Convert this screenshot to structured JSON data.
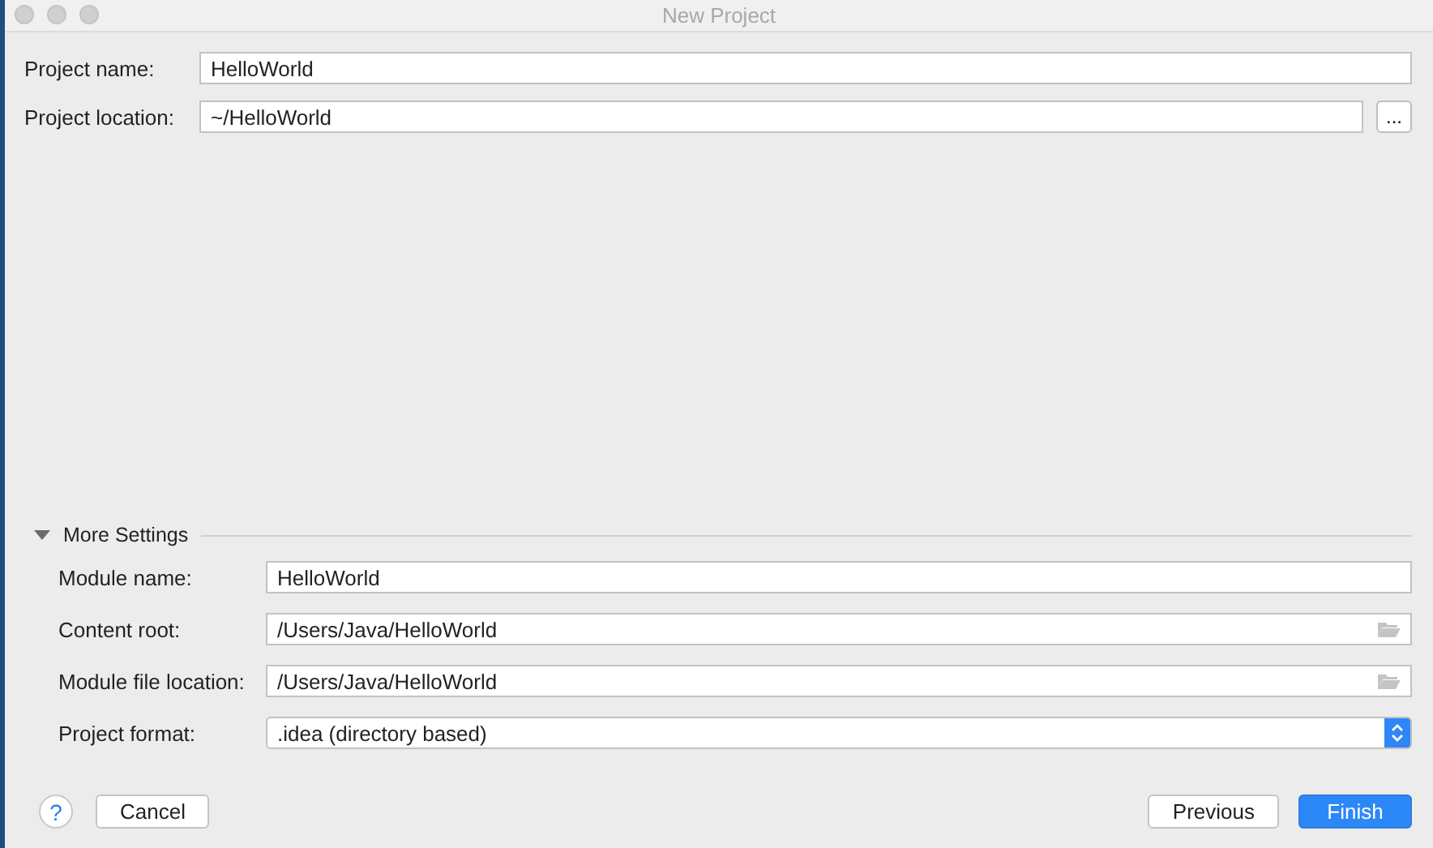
{
  "window": {
    "title": "New Project"
  },
  "project_fields": [
    {
      "label": "Project name:",
      "value": "HelloWorld",
      "kind": "text"
    },
    {
      "label": "Project location:",
      "value": "~/HelloWorld",
      "kind": "browse",
      "button": "..."
    }
  ],
  "more_settings": {
    "label": "More Settings",
    "expanded": true,
    "fields": [
      {
        "label": "Module name:",
        "value": "HelloWorld",
        "kind": "text"
      },
      {
        "label": "Content root:",
        "value": "/Users/Java/HelloWorld",
        "kind": "folder"
      },
      {
        "label": "Module file location:",
        "value": "/Users/Java/HelloWorld",
        "kind": "folder"
      },
      {
        "label": "Project format:",
        "value": ".idea (directory based)",
        "kind": "select"
      }
    ]
  },
  "help": {
    "label": "?"
  },
  "left_buttons": [
    {
      "label": "Cancel",
      "kind": "normal"
    }
  ],
  "right_buttons": [
    {
      "label": "Previous",
      "kind": "normal"
    },
    {
      "label": "Finish",
      "kind": "default"
    }
  ]
}
